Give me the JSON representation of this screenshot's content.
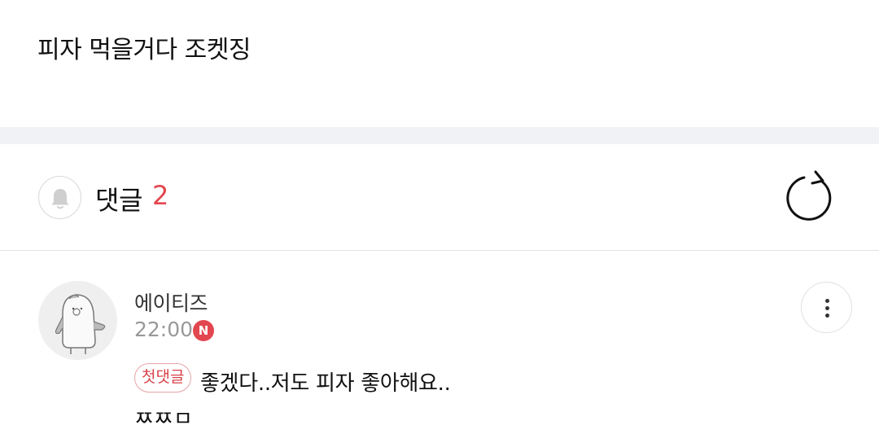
{
  "post": {
    "text": "피자 먹을거다 조켓징"
  },
  "comments_header": {
    "title": "댓글",
    "count": "2"
  },
  "comments": [
    {
      "author": "에이티즈",
      "time": "22:00",
      "badge": "N",
      "first_comment_label": "첫댓글",
      "text_line1": "좋겠다..저도 피자 좋아해요..",
      "text_line2": "ㅉㅉㅁ"
    }
  ],
  "colors": {
    "accent": "#e2474f",
    "divider_band": "#f1f2f6"
  },
  "icons": {
    "bell": "bell-icon",
    "refresh": "refresh-icon",
    "more": "more-vertical-icon"
  }
}
